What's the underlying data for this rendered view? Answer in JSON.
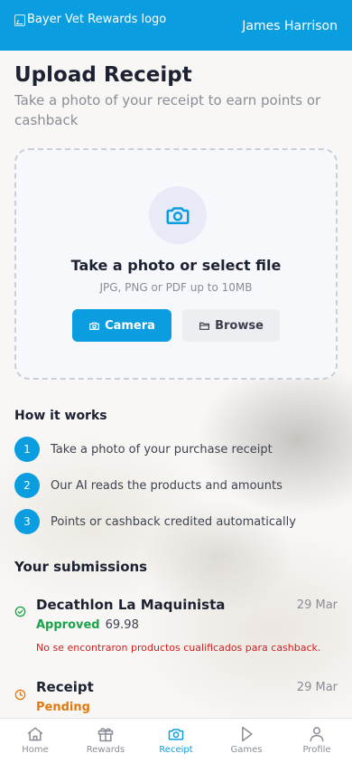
{
  "header": {
    "logo_alt": "Bayer Vet Rewards logo",
    "user_name": "James Harrison"
  },
  "page": {
    "title": "Upload Receipt",
    "subtitle": "Take a photo of your receipt to earn points or cashback"
  },
  "upload": {
    "icon": "camera-icon",
    "title": "Take a photo or select file",
    "hint": "JPG, PNG or PDF up to 10MB",
    "camera_label": "Camera",
    "browse_label": "Browse"
  },
  "how_it_works": {
    "title": "How it works",
    "steps": [
      {
        "num": "1",
        "text": "Take a photo of your purchase receipt"
      },
      {
        "num": "2",
        "text": "Our AI reads the products and amounts"
      },
      {
        "num": "3",
        "text": "Points or cashback credited automatically"
      }
    ]
  },
  "submissions": {
    "title": "Your submissions",
    "items": [
      {
        "name": "Decathlon La Maquinista",
        "date": "29 Mar",
        "status": "Approved",
        "amount": "69.98",
        "message": "No se encontraron productos cualificados para cashback.",
        "icon": "check-circle-icon"
      },
      {
        "name": "Receipt",
        "date": "29 Mar",
        "status": "Pending",
        "amount": "",
        "message": "",
        "icon": "clock-icon"
      }
    ]
  },
  "tabs": [
    {
      "label": "Home",
      "icon": "home-icon",
      "active": false
    },
    {
      "label": "Rewards",
      "icon": "gift-icon",
      "active": false
    },
    {
      "label": "Receipt",
      "icon": "camera-icon",
      "active": true
    },
    {
      "label": "Games",
      "icon": "play-icon",
      "active": false
    },
    {
      "label": "Profile",
      "icon": "user-icon",
      "active": false
    }
  ],
  "colors": {
    "primary": "#0a9ee0",
    "approved": "#1aa34a",
    "pending": "#e07a10",
    "error": "#d31d1d"
  }
}
